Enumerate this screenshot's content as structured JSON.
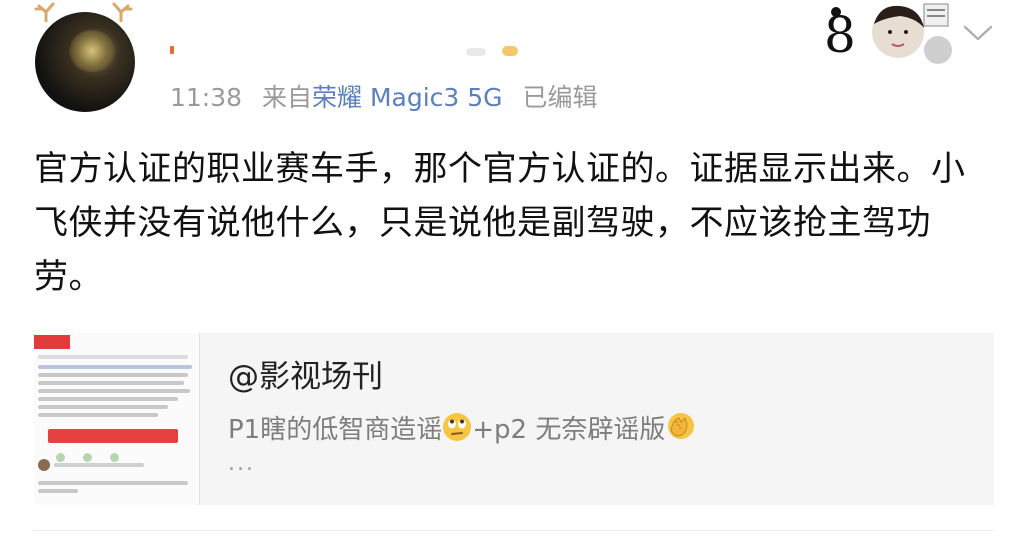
{
  "post": {
    "time": "11:38",
    "source_prefix": "来自",
    "device": "荣耀 Magic3 5G",
    "edited": "已编辑",
    "text": "官方认证的职业赛车手，那个官方认证的。证据显示出来。小飞侠并没有说他什么，只是说他是副驾驶，不应该抢主驾功劳。"
  },
  "card": {
    "title": "@影视场刊",
    "desc_part1": "P1瞎的低智商造谣",
    "desc_part2": "+p2 无奈辟谣版",
    "more": "..."
  },
  "colors": {
    "device_link": "#5b7fbf",
    "meta_gray": "#9a9a9a",
    "card_bg": "#f5f5f5"
  },
  "icons": {
    "avatar": "user-avatar",
    "antlers": "antler-decoration-icon",
    "badge": "fan-badge-icon",
    "chevron": "chevron-down-icon",
    "emoji1": "eye-roll-emoji-icon",
    "emoji2": "facepalm-emoji-icon"
  }
}
